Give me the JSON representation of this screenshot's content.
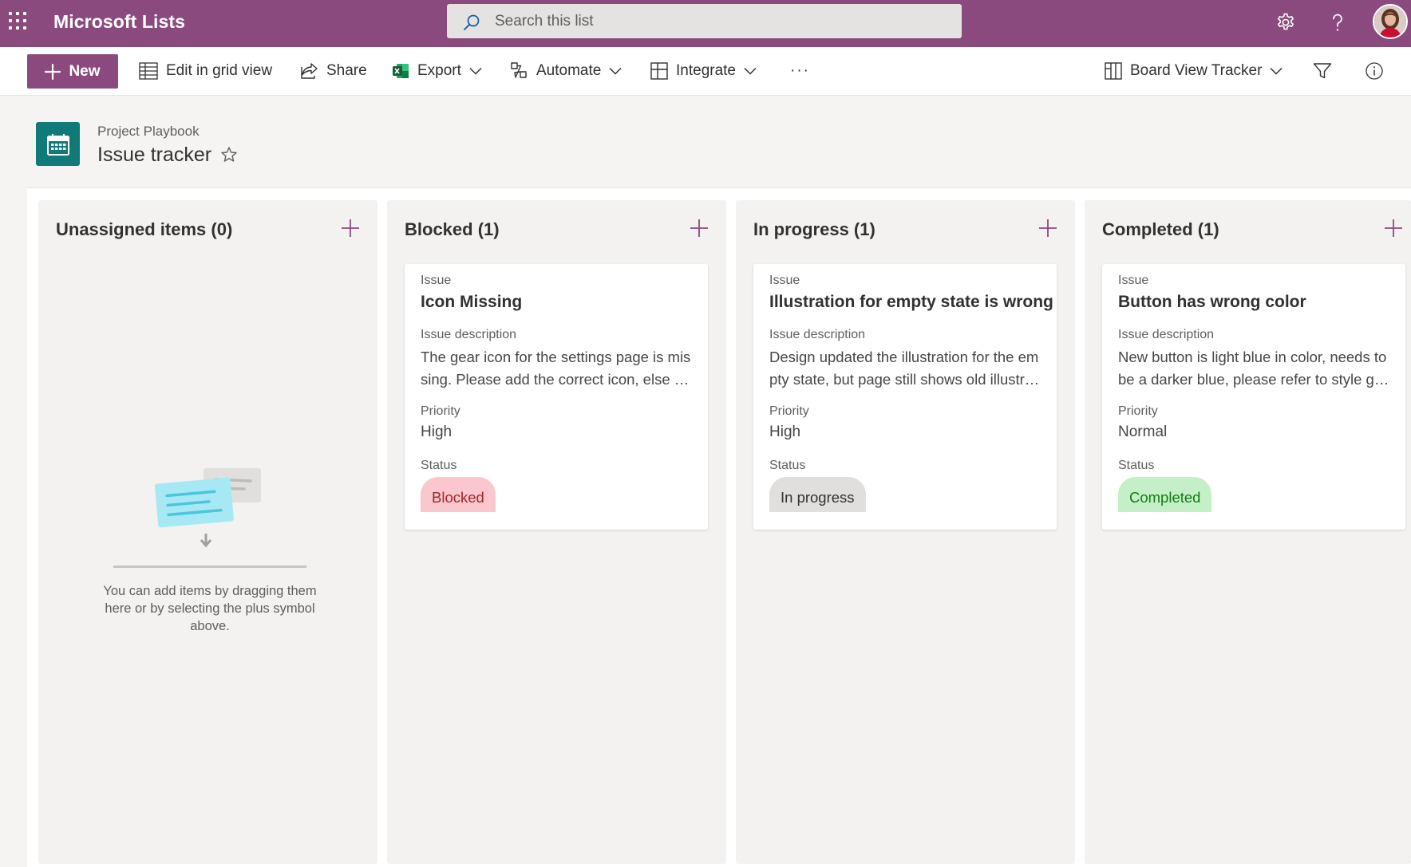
{
  "suite": {
    "app_title": "Microsoft Lists",
    "search_placeholder": "Search this list",
    "icons": [
      "waffle-icon",
      "settings-gear-icon",
      "help-question-icon",
      "user-avatar"
    ]
  },
  "toolbar": {
    "new_label": "New",
    "edit_grid_label": "Edit in grid view",
    "share_label": "Share",
    "export_label": "Export",
    "automate_label": "Automate",
    "integrate_label": "Integrate",
    "more_label": "···",
    "view_label": "Board View Tracker"
  },
  "header": {
    "breadcrumb": "Project Playbook",
    "title": "Issue tracker"
  },
  "board": {
    "columns": [
      {
        "title": "Unassigned items (0)",
        "empty_text": "You can add items by dragging them here or by selecting the plus symbol above."
      },
      {
        "title": "Blocked (1)",
        "card": {
          "issue_label": "Issue",
          "issue": "Icon Missing",
          "desc_label": "Issue description",
          "desc": "The gear icon for the settings page is missing. Please add the correct icon, else users will not find it.",
          "priority_label": "Priority",
          "priority": "High",
          "status_label": "Status",
          "status": "Blocked"
        }
      },
      {
        "title": "In progress (1)",
        "card": {
          "issue_label": "Issue",
          "issue": "Illustration for empty state is wrong",
          "desc_label": "Issue description",
          "desc": "Design updated the illustration for the empty state, but page still shows old illustration.",
          "priority_label": "Priority",
          "priority": "High",
          "status_label": "Status",
          "status": "In progress"
        }
      },
      {
        "title": "Completed (1)",
        "card": {
          "issue_label": "Issue",
          "issue": "Button has wrong color",
          "desc_label": "Issue description",
          "desc": "New button is light blue in color, needs to be a darker blue, please refer to style guide.",
          "priority_label": "Priority",
          "priority": "Normal",
          "status_label": "Status",
          "status": "Completed"
        }
      }
    ]
  },
  "colors": {
    "brand": "#8b4a7e",
    "blocked_bg": "#f9c7cd",
    "blocked_fg": "#a4262c",
    "inprogress_bg": "#e1dfdd",
    "completed_bg": "#c5f0c7",
    "completed_fg": "#107c10"
  }
}
